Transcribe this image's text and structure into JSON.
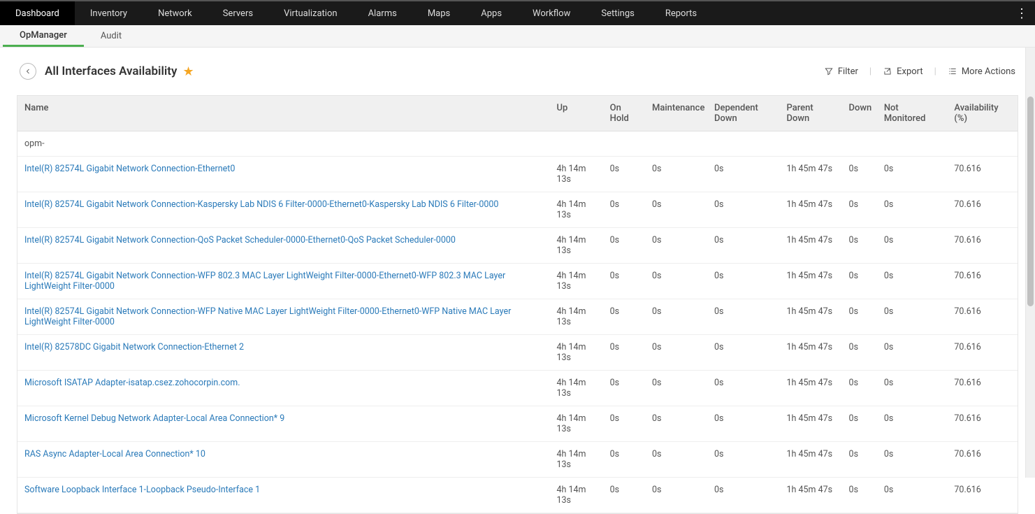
{
  "top_nav": {
    "items": [
      "Dashboard",
      "Inventory",
      "Network",
      "Servers",
      "Virtualization",
      "Alarms",
      "Maps",
      "Apps",
      "Workflow",
      "Settings",
      "Reports"
    ],
    "active": 0
  },
  "sub_nav": {
    "items": [
      "OpManager",
      "Audit"
    ],
    "active": 0
  },
  "page": {
    "title": "All Interfaces Availability",
    "filter": "Filter",
    "export": "Export",
    "more": "More Actions"
  },
  "table": {
    "headers": [
      "Name",
      "Up",
      "On Hold",
      "Maintenance",
      "Dependent Down",
      "Parent Down",
      "Down",
      "Not Monitored",
      "Availability (%)"
    ],
    "group": "opm-",
    "rows": [
      {
        "name": "Intel(R) 82574L Gigabit Network Connection-Ethernet0",
        "up": "4h 14m 13s",
        "hold": "0s",
        "maint": "0s",
        "dep": "0s",
        "par": "1h 45m 47s",
        "down": "0s",
        "nm": "0s",
        "av": "70.616"
      },
      {
        "name": "Intel(R) 82574L Gigabit Network Connection-Kaspersky Lab NDIS 6 Filter-0000-Ethernet0-Kaspersky Lab NDIS 6 Filter-0000",
        "up": "4h 14m 13s",
        "hold": "0s",
        "maint": "0s",
        "dep": "0s",
        "par": "1h 45m 47s",
        "down": "0s",
        "nm": "0s",
        "av": "70.616"
      },
      {
        "name": "Intel(R) 82574L Gigabit Network Connection-QoS Packet Scheduler-0000-Ethernet0-QoS Packet Scheduler-0000",
        "up": "4h 14m 13s",
        "hold": "0s",
        "maint": "0s",
        "dep": "0s",
        "par": "1h 45m 47s",
        "down": "0s",
        "nm": "0s",
        "av": "70.616"
      },
      {
        "name": "Intel(R) 82574L Gigabit Network Connection-WFP 802.3 MAC Layer LightWeight Filter-0000-Ethernet0-WFP 802.3 MAC Layer LightWeight Filter-0000",
        "up": "4h 14m 13s",
        "hold": "0s",
        "maint": "0s",
        "dep": "0s",
        "par": "1h 45m 47s",
        "down": "0s",
        "nm": "0s",
        "av": "70.616"
      },
      {
        "name": "Intel(R) 82574L Gigabit Network Connection-WFP Native MAC Layer LightWeight Filter-0000-Ethernet0-WFP Native MAC Layer LightWeight Filter-0000",
        "up": "4h 14m 13s",
        "hold": "0s",
        "maint": "0s",
        "dep": "0s",
        "par": "1h 45m 47s",
        "down": "0s",
        "nm": "0s",
        "av": "70.616"
      },
      {
        "name": "Intel(R) 82578DC Gigabit Network Connection-Ethernet 2",
        "up": "4h 14m 13s",
        "hold": "0s",
        "maint": "0s",
        "dep": "0s",
        "par": "1h 45m 47s",
        "down": "0s",
        "nm": "0s",
        "av": "70.616"
      },
      {
        "name": "Microsoft ISATAP Adapter-isatap.csez.zohocorpin.com.",
        "up": "4h 14m 13s",
        "hold": "0s",
        "maint": "0s",
        "dep": "0s",
        "par": "1h 45m 47s",
        "down": "0s",
        "nm": "0s",
        "av": "70.616"
      },
      {
        "name": "Microsoft Kernel Debug Network Adapter-Local Area Connection* 9",
        "up": "4h 14m 13s",
        "hold": "0s",
        "maint": "0s",
        "dep": "0s",
        "par": "1h 45m 47s",
        "down": "0s",
        "nm": "0s",
        "av": "70.616"
      },
      {
        "name": "RAS Async Adapter-Local Area Connection* 10",
        "up": "4h 14m 13s",
        "hold": "0s",
        "maint": "0s",
        "dep": "0s",
        "par": "1h 45m 47s",
        "down": "0s",
        "nm": "0s",
        "av": "70.616"
      },
      {
        "name": "Software Loopback Interface 1-Loopback Pseudo-Interface 1",
        "up": "4h 14m 13s",
        "hold": "0s",
        "maint": "0s",
        "dep": "0s",
        "par": "1h 45m 47s",
        "down": "0s",
        "nm": "0s",
        "av": "70.616"
      }
    ]
  }
}
